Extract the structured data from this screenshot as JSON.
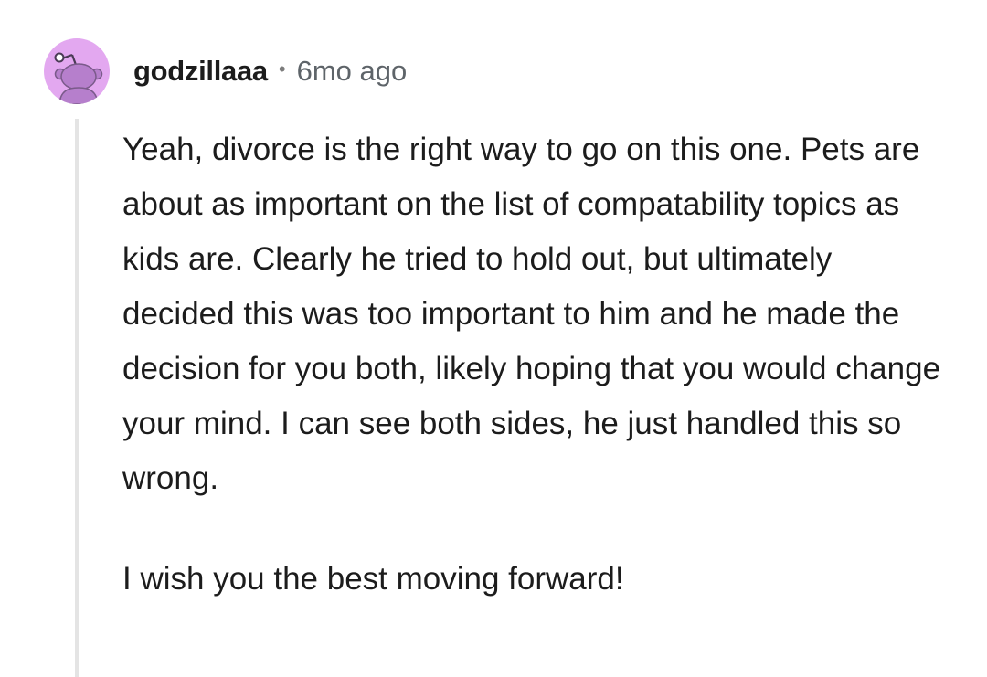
{
  "comment": {
    "username": "godzillaaa",
    "separator": "•",
    "timestamp": "6mo ago",
    "avatar_icon": "snoo-avatar-icon",
    "avatar_bg": "#e3a8f0",
    "paragraphs": [
      "Yeah, divorce is the right way to go on this one. Pets are about as important on the list of compatability topics as kids are. Clearly he tried to hold out, but ultimately decided this was too important to him and he made the decision for you both, likely hoping that you would change your mind. I can see both sides, he just handled this so wrong.",
      "I wish you the best moving forward!"
    ]
  }
}
